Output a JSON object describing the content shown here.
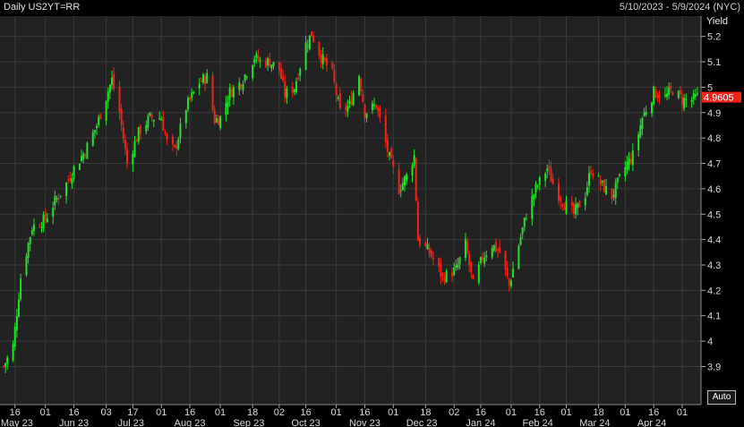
{
  "header": {
    "title": "Daily US2YT=RR",
    "date_range": "5/10/2023 - 5/9/2024 (NYC)"
  },
  "auto_button": "Auto",
  "chart_data": {
    "type": "candlestick",
    "title": "Daily US2YT=RR",
    "ylabel": "Yield",
    "ylim": [
      3.75,
      5.28
    ],
    "xlim": [
      "2023-05-10",
      "2024-05-09"
    ],
    "last_value": "4.9605",
    "up_color": "#22e22a",
    "down_color": "#f0221a",
    "background": "#222222",
    "grid": true,
    "y_ticks": [
      "3.9",
      "4",
      "4.1",
      "4.2",
      "4.3",
      "4.4",
      "4.5",
      "4.6",
      "4.7",
      "4.8",
      "4.9",
      "5",
      "5.1",
      "5.2"
    ],
    "x_ticks": [
      {
        "label": "16",
        "date": "2023-05-16"
      },
      {
        "label": "01",
        "date": "2023-06-01"
      },
      {
        "label": "16",
        "date": "2023-06-16"
      },
      {
        "label": "03",
        "date": "2023-07-03"
      },
      {
        "label": "17",
        "date": "2023-07-17"
      },
      {
        "label": "01",
        "date": "2023-08-01"
      },
      {
        "label": "16",
        "date": "2023-08-16"
      },
      {
        "label": "01",
        "date": "2023-09-01"
      },
      {
        "label": "18",
        "date": "2023-09-18"
      },
      {
        "label": "02",
        "date": "2023-10-02"
      },
      {
        "label": "16",
        "date": "2023-10-16"
      },
      {
        "label": "01",
        "date": "2023-11-01"
      },
      {
        "label": "16",
        "date": "2023-11-16"
      },
      {
        "label": "01",
        "date": "2023-12-01"
      },
      {
        "label": "18",
        "date": "2023-12-18"
      },
      {
        "label": "02",
        "date": "2024-01-02"
      },
      {
        "label": "16",
        "date": "2024-01-16"
      },
      {
        "label": "01",
        "date": "2024-02-01"
      },
      {
        "label": "16",
        "date": "2024-02-16"
      },
      {
        "label": "01",
        "date": "2024-03-01"
      },
      {
        "label": "18",
        "date": "2024-03-18"
      },
      {
        "label": "01",
        "date": "2024-04-01"
      },
      {
        "label": "16",
        "date": "2024-04-16"
      },
      {
        "label": "01",
        "date": "2024-05-01"
      }
    ],
    "months": [
      {
        "label": "May 23",
        "date": "2023-05-17"
      },
      {
        "label": "Jun 23",
        "date": "2023-06-16"
      },
      {
        "label": "Jul 23",
        "date": "2023-07-16"
      },
      {
        "label": "Aug 23",
        "date": "2023-08-16"
      },
      {
        "label": "Sep 23",
        "date": "2023-09-16"
      },
      {
        "label": "Oct 23",
        "date": "2023-10-16"
      },
      {
        "label": "Nov 23",
        "date": "2023-11-16"
      },
      {
        "label": "Dec 23",
        "date": "2023-12-16"
      },
      {
        "label": "Jan 24",
        "date": "2024-01-16"
      },
      {
        "label": "Feb 24",
        "date": "2024-02-15"
      },
      {
        "label": "Mar 24",
        "date": "2024-03-16"
      },
      {
        "label": "Apr 24",
        "date": "2024-04-15"
      }
    ],
    "close_path": [
      [
        "2023-05-10",
        3.9
      ],
      [
        "2023-05-15",
        3.98
      ],
      [
        "2023-05-19",
        4.25
      ],
      [
        "2023-05-25",
        4.45
      ],
      [
        "2023-06-01",
        4.48
      ],
      [
        "2023-06-06",
        4.55
      ],
      [
        "2023-06-12",
        4.62
      ],
      [
        "2023-06-16",
        4.68
      ],
      [
        "2023-06-22",
        4.75
      ],
      [
        "2023-06-28",
        4.85
      ],
      [
        "2023-07-06",
        5.03
      ],
      [
        "2023-07-10",
        4.9
      ],
      [
        "2023-07-14",
        4.7
      ],
      [
        "2023-07-20",
        4.82
      ],
      [
        "2023-07-26",
        4.88
      ],
      [
        "2023-08-01",
        4.88
      ],
      [
        "2023-08-04",
        4.78
      ],
      [
        "2023-08-08",
        4.75
      ],
      [
        "2023-08-14",
        4.92
      ],
      [
        "2023-08-21",
        5.02
      ],
      [
        "2023-08-25",
        5.04
      ],
      [
        "2023-08-29",
        4.87
      ],
      [
        "2023-09-01",
        4.88
      ],
      [
        "2023-09-06",
        4.98
      ],
      [
        "2023-09-12",
        5.02
      ],
      [
        "2023-09-19",
        5.12
      ],
      [
        "2023-09-22",
        5.1
      ],
      [
        "2023-09-27",
        5.1
      ],
      [
        "2023-10-02",
        5.07
      ],
      [
        "2023-10-05",
        4.97
      ],
      [
        "2023-10-10",
        5.0
      ],
      [
        "2023-10-16",
        5.17
      ],
      [
        "2023-10-19",
        5.21
      ],
      [
        "2023-10-24",
        5.12
      ],
      [
        "2023-10-30",
        5.05
      ],
      [
        "2023-11-03",
        4.9
      ],
      [
        "2023-11-08",
        4.93
      ],
      [
        "2023-11-13",
        5.05
      ],
      [
        "2023-11-16",
        4.9
      ],
      [
        "2023-11-22",
        4.93
      ],
      [
        "2023-11-29",
        4.72
      ],
      [
        "2023-12-04",
        4.6
      ],
      [
        "2023-12-08",
        4.65
      ],
      [
        "2023-12-12",
        4.73
      ],
      [
        "2023-12-14",
        4.4
      ],
      [
        "2023-12-20",
        4.35
      ],
      [
        "2023-12-27",
        4.25
      ],
      [
        "2024-01-03",
        4.28
      ],
      [
        "2024-01-08",
        4.38
      ],
      [
        "2024-01-12",
        4.22
      ],
      [
        "2024-01-17",
        4.33
      ],
      [
        "2024-01-22",
        4.38
      ],
      [
        "2024-01-26",
        4.35
      ],
      [
        "2024-01-31",
        4.22
      ],
      [
        "2024-02-05",
        4.38
      ],
      [
        "2024-02-09",
        4.5
      ],
      [
        "2024-02-14",
        4.6
      ],
      [
        "2024-02-20",
        4.68
      ],
      [
        "2024-02-23",
        4.62
      ],
      [
        "2024-02-28",
        4.55
      ],
      [
        "2024-03-05",
        4.5
      ],
      [
        "2024-03-11",
        4.58
      ],
      [
        "2024-03-14",
        4.68
      ],
      [
        "2024-03-19",
        4.62
      ],
      [
        "2024-03-25",
        4.57
      ],
      [
        "2024-03-28",
        4.62
      ],
      [
        "2024-04-02",
        4.7
      ],
      [
        "2024-04-05",
        4.73
      ],
      [
        "2024-04-10",
        4.88
      ],
      [
        "2024-04-16",
        4.98
      ],
      [
        "2024-04-22",
        4.96
      ],
      [
        "2024-04-26",
        4.99
      ],
      [
        "2024-05-01",
        4.95
      ],
      [
        "2024-05-06",
        4.95
      ],
      [
        "2024-05-09",
        4.96
      ]
    ]
  }
}
